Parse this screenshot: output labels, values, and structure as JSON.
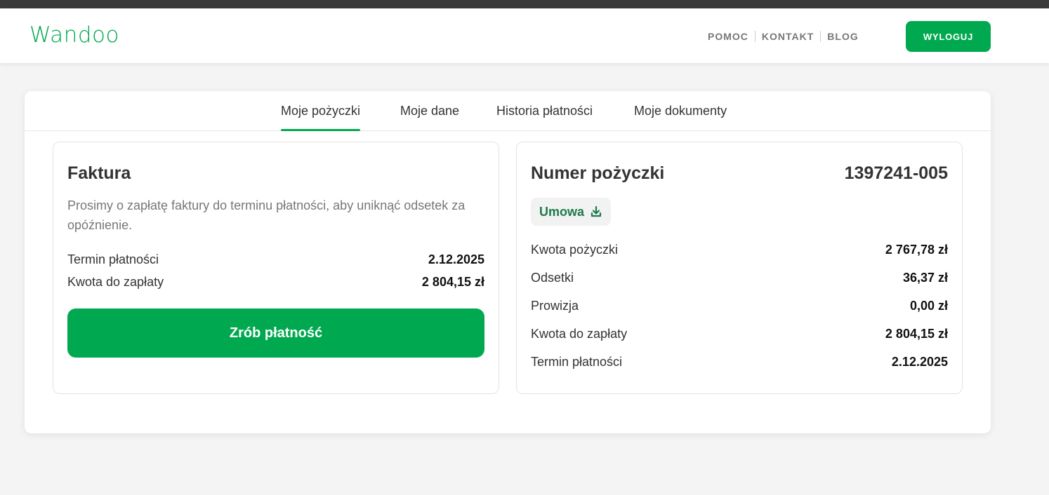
{
  "header": {
    "logo": "Wandoo",
    "nav": [
      "POMOC",
      "KONTAKT",
      "BLOG"
    ],
    "logout_label": "WYLOGUJ"
  },
  "tabs": [
    {
      "label": "Moje pożyczki",
      "active": true
    },
    {
      "label": "Moje dane",
      "active": false
    },
    {
      "label": "Historia płatności",
      "active": false
    },
    {
      "label": "Moje dokumenty",
      "active": false
    }
  ],
  "invoice": {
    "title": "Faktura",
    "description": "Prosimy o zapłatę faktury do terminu płatności, aby uniknąć odsetek za opóźnienie.",
    "rows": [
      {
        "label": "Termin płatności",
        "value": "2.12.2025"
      },
      {
        "label": "Kwota do zapłaty",
        "value": "2 804,15 zł"
      }
    ],
    "pay_button": "Zrób płatność"
  },
  "loan": {
    "title": "Numer pożyczki",
    "number": "1397241-005",
    "contract_label": "Umowa",
    "contract_icon": "download-icon",
    "rows": [
      {
        "label": "Kwota pożyczki",
        "value": "2 767,78 zł"
      },
      {
        "label": "Odsetki",
        "value": "36,37 zł"
      },
      {
        "label": "Prowizja",
        "value": "0,00 zł"
      },
      {
        "label": "Kwota do zapłaty",
        "value": "2 804,15 zł"
      },
      {
        "label": "Termin płatności",
        "value": "2.12.2025"
      }
    ]
  },
  "colors": {
    "brand_green": "#00a94f",
    "dark_green_text": "#1e7a4c",
    "page_bg": "#f4f4f4"
  }
}
